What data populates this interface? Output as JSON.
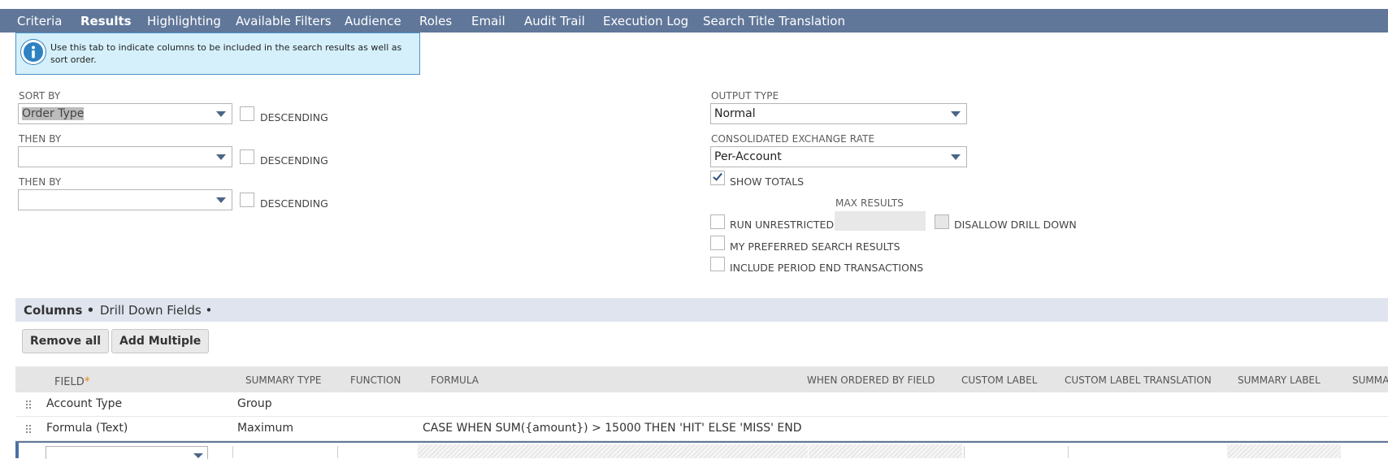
{
  "tabs": [
    {
      "label": "Criteria",
      "active": false
    },
    {
      "label": "Results",
      "active": true
    },
    {
      "label": "Highlighting",
      "active": false
    },
    {
      "label": "Available Filters",
      "active": false
    },
    {
      "label": "Audience",
      "active": false
    },
    {
      "label": "Roles",
      "active": false
    },
    {
      "label": "Email",
      "active": false
    },
    {
      "label": "Audit Trail",
      "active": false
    },
    {
      "label": "Execution Log",
      "active": false
    },
    {
      "label": "Search Title Translation",
      "active": false
    }
  ],
  "info": {
    "text": "Use this tab to indicate columns to be included in the search results as well as sort order."
  },
  "sort": {
    "sort_by_label": "SORT BY",
    "sort_by_value": "Order Type",
    "then_by_label": "THEN BY",
    "then_by_2_label": "THEN BY",
    "descending_label": "DESCENDING"
  },
  "output": {
    "output_type_label": "OUTPUT TYPE",
    "output_type_value": "Normal",
    "exchange_rate_label": "CONSOLIDATED EXCHANGE RATE",
    "exchange_rate_value": "Per-Account",
    "show_totals_label": "SHOW TOTALS",
    "show_totals_checked": true,
    "max_results_label": "MAX RESULTS",
    "run_unrestricted_label": "RUN UNRESTRICTED",
    "disallow_drill_down_label": "DISALLOW DRILL DOWN",
    "preferred_label": "MY PREFERRED SEARCH RESULTS",
    "period_end_label": "INCLUDE PERIOD END TRANSACTIONS"
  },
  "subtabs": [
    {
      "label": "Columns •",
      "active": true
    },
    {
      "label": "Drill Down Fields •",
      "active": false
    }
  ],
  "buttons": {
    "remove_all": "Remove all",
    "add_multiple": "Add Multiple"
  },
  "table": {
    "headers": {
      "field": "FIELD",
      "summary_type": "SUMMARY TYPE",
      "function": "FUNCTION",
      "formula": "FORMULA",
      "when_ordered": "WHEN ORDERED BY FIELD",
      "custom_label": "CUSTOM LABEL",
      "custom_label_translation": "CUSTOM LABEL TRANSLATION",
      "summary_label": "SUMMARY LABEL",
      "summa": "SUMMA"
    },
    "required_mark": "*",
    "rows": [
      {
        "field": "Account Type",
        "summary_type": "Group",
        "formula": ""
      },
      {
        "field": "Formula (Text)",
        "summary_type": "Maximum",
        "formula": "CASE WHEN SUM({amount}) > 15000 THEN 'HIT' ELSE 'MISS' END"
      }
    ]
  },
  "colors": {
    "tabbar": "#607799",
    "info_bg": "#d5f0fb",
    "info_icon": "#2e82c1",
    "subtab_bg": "#dfe4ee",
    "required": "#e38b1c"
  },
  "icons": {
    "info": "info-icon",
    "dropdown": "chevron-down-icon",
    "drag": "drag-handle-icon",
    "check": "checkmark-icon"
  }
}
